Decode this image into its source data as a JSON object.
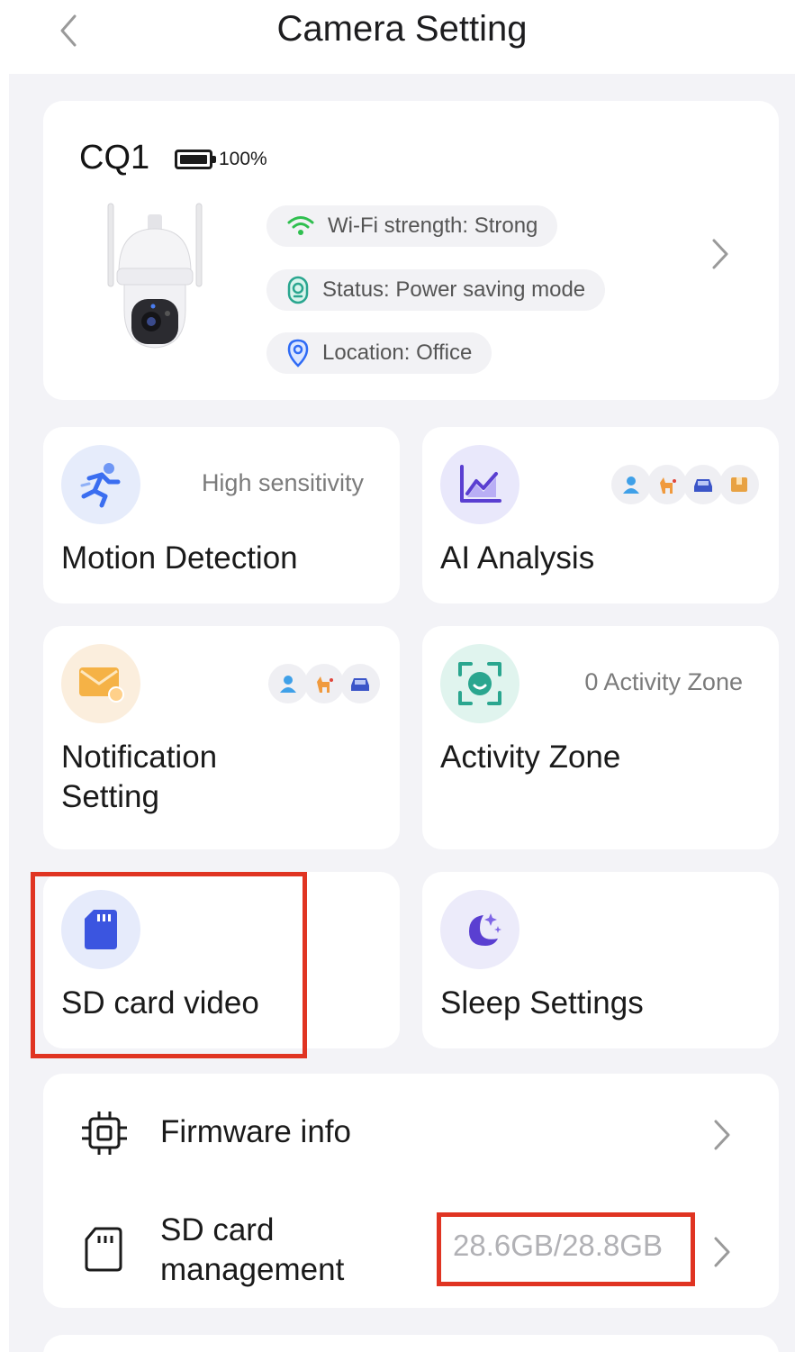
{
  "header": {
    "title": "Camera Setting"
  },
  "device": {
    "name": "CQ1",
    "battery_text": "100%",
    "wifi_text": "Wi-Fi strength: Strong",
    "status_text": "Status: Power saving mode",
    "location_text": "Location: Office"
  },
  "tiles": {
    "motion": {
      "label": "Motion Detection",
      "sub": "High sensitivity"
    },
    "ai": {
      "label": "AI Analysis"
    },
    "notification": {
      "label_line1": "Notification",
      "label_line2": "Setting"
    },
    "zone": {
      "label": "Activity Zone",
      "sub": "0 Activity Zone"
    },
    "sd": {
      "label": "SD card video"
    },
    "sleep": {
      "label": "Sleep Settings"
    }
  },
  "list": {
    "firmware": {
      "label": "Firmware info"
    },
    "sd_management": {
      "label_line1": "SD card",
      "label_line2": "management",
      "value": "28.6GB/28.8GB"
    }
  },
  "colors": {
    "accent_blue": "#3b55e0",
    "highlight_red": "#e03422",
    "wifi_green": "#2fbf4f",
    "status_teal": "#2aa68f",
    "location_blue": "#2f6bf5"
  }
}
